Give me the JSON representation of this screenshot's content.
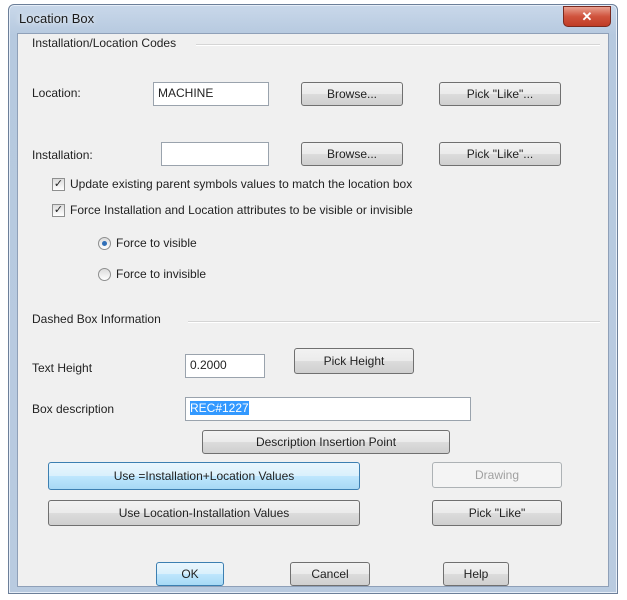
{
  "window": {
    "title": "Location Box",
    "close_glyph": "✕"
  },
  "codes_group": {
    "label": "Installation/Location Codes"
  },
  "location": {
    "label": "Location:",
    "value": "MACHINE",
    "browse": "Browse...",
    "pick_like": "Pick \"Like\"..."
  },
  "installation": {
    "label": "Installation:",
    "value": "",
    "browse": "Browse...",
    "pick_like": "Pick \"Like\"..."
  },
  "options": {
    "update_parent": {
      "label": "Update existing parent symbols values to match the location box",
      "checked": true
    },
    "force_attrs": {
      "label": "Force Installation and Location attributes to be visible or invisible",
      "checked": true
    },
    "force_visible": {
      "label": "Force to visible",
      "selected": true
    },
    "force_invisible": {
      "label": "Force to invisible",
      "selected": false
    }
  },
  "dashed_group": {
    "label": "Dashed Box Information"
  },
  "text_height": {
    "label": "Text Height",
    "value": "0.2000",
    "pick_height": "Pick Height"
  },
  "box_description": {
    "label": "Box description",
    "value": "REC#1227",
    "insertion_point": "Description Insertion Point"
  },
  "buttons": {
    "use_plus": "Use =Installation+Location Values",
    "drawing": "Drawing",
    "use_minus": "Use Location-Installation Values",
    "pick_like": "Pick \"Like\"",
    "ok": "OK",
    "cancel": "Cancel",
    "help": "Help"
  },
  "check_glyph": "✓"
}
